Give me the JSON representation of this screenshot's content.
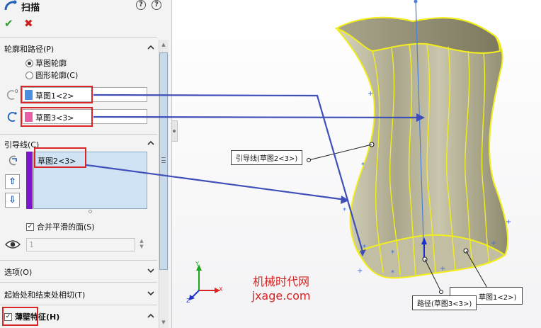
{
  "panel": {
    "title": "扫描",
    "help_icons": [
      "?",
      "?"
    ],
    "profile_path": {
      "section_title": "轮廓和路径(P)",
      "radio_options": [
        {
          "label": "草图轮廓",
          "selected": true
        },
        {
          "label": "圆形轮廓(C)",
          "selected": false
        }
      ],
      "profile_value": "草图1<2>",
      "path_value": "草图3<3>",
      "profile_color": "#4a90e2",
      "path_color": "#e85fa8"
    },
    "guide": {
      "section_title": "引导线(C)",
      "items": [
        "草图2<3>"
      ],
      "merge_faces_label": "合并平滑的面(S)",
      "merge_faces_checked": true,
      "count_value": "1",
      "up_label": "⇧",
      "down_label": "⇩"
    },
    "collapsed_sections": [
      {
        "title": "选项(O)"
      },
      {
        "title": "起始处和结束处相切(T)"
      },
      {
        "title": "薄壁特征(H)",
        "checked": true
      }
    ]
  },
  "viewport": {
    "callout_guide": "引导线(草图2<3>)",
    "callout_path": "路径(草图3<3>)",
    "callout_profile_partial": "草图1<2>)",
    "triad": {
      "x": "X",
      "y": "Y",
      "z": "Z"
    },
    "watermark_line1": "机械时代网",
    "watermark_line2": "jxage.com"
  },
  "colors": {
    "accent_red": "#d82626",
    "arrow_blue": "#3f4fb8",
    "body_fill": "#b9b596",
    "edge_yellow": "#f2ee1c",
    "guide_bar": "#7b16cf"
  }
}
